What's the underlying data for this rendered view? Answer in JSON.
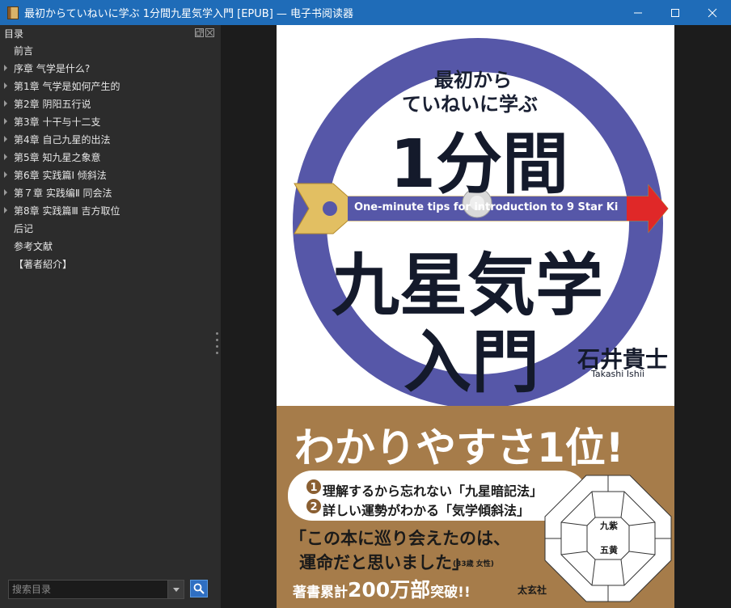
{
  "window": {
    "title": "最初からていねいに学ぶ 1分間九星気学入門 [EPUB] — 电子书阅读器"
  },
  "toc": {
    "header": "目录",
    "items": [
      {
        "label": "前言",
        "expandable": false
      },
      {
        "label": "序章 气学是什么?",
        "expandable": true
      },
      {
        "label": "第1章 气学是如何产生的",
        "expandable": true
      },
      {
        "label": "第2章 阴阳五行说",
        "expandable": true
      },
      {
        "label": "第3章 十干与十二支",
        "expandable": true
      },
      {
        "label": "第4章 自己九星的出法",
        "expandable": true
      },
      {
        "label": "第5章 知九星之象意",
        "expandable": true
      },
      {
        "label": "第6章 实践篇Ⅰ 倾斜法",
        "expandable": true
      },
      {
        "label": "第７章 实践编Ⅱ 同会法",
        "expandable": true
      },
      {
        "label": "第8章 实践篇Ⅲ 吉方取位",
        "expandable": true
      },
      {
        "label": "后记",
        "expandable": false
      },
      {
        "label": "参考文献",
        "expandable": false
      },
      {
        "label": "【著者紹介】",
        "expandable": false
      }
    ],
    "search_placeholder": "搜索目录"
  },
  "cover": {
    "subtitle_line1": "最初から",
    "subtitle_line2": "ていねいに学ぶ",
    "title_main": "1分間",
    "arrow_text": "One-minute tips for introduction to 9 Star Ki",
    "title_line2": "九星気学",
    "title_line3": "入門",
    "author_jp": "石井貴士",
    "author_en": "Takashi Ishii",
    "headline": "わかりやすさ1位!",
    "point1": "理解するから忘れない「九星暗記法」",
    "point2": "詳しい運勢がわかる「気学傾斜法」",
    "quote_line1": "「この本に巡り会えたのは、",
    "quote_line2": "運命だと思いました」",
    "quote_credit": "(33歳 女性)",
    "sales_prefix": "著書累計",
    "sales_number": "200万部",
    "sales_suffix": "突破!!",
    "publisher": "太玄社",
    "diagram_center1": "九紫",
    "diagram_center2": "五黄",
    "colors": {
      "ring": "#5657a8",
      "arrow_gold": "#e2bf62",
      "arrow_red": "#e02828",
      "lower_panel": "#a67c4a"
    }
  }
}
